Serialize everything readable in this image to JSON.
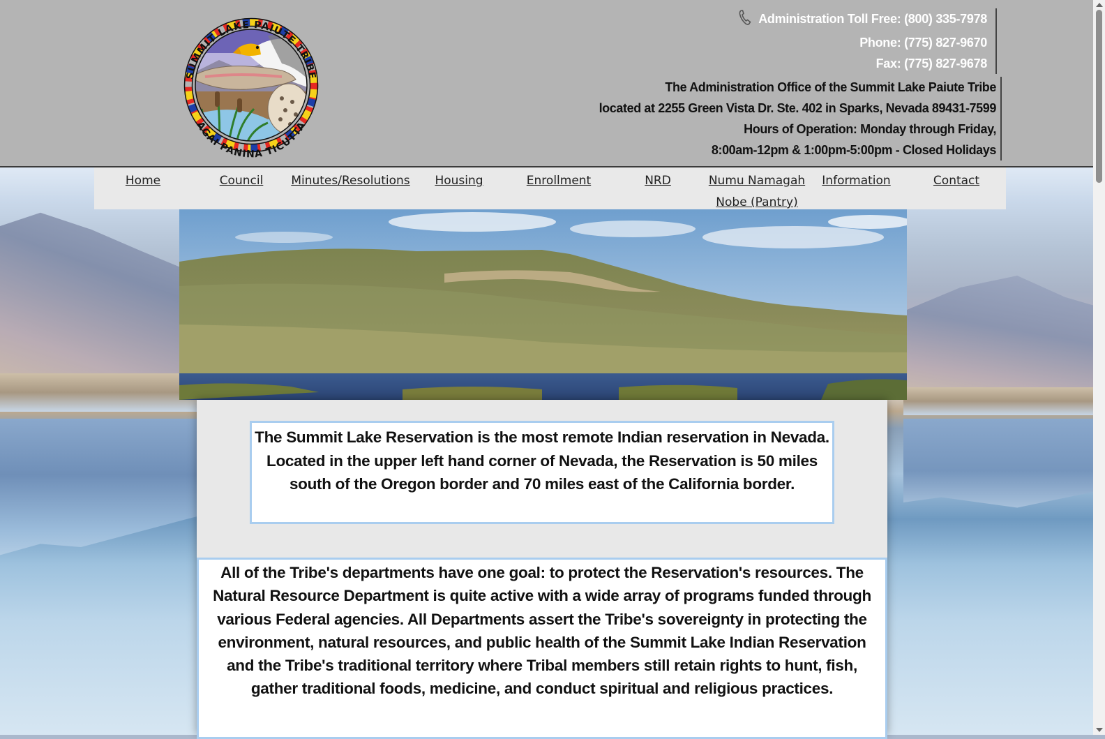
{
  "header": {
    "logo_text_top": "SUMMIT LAKE PAIUTE TRIBE",
    "logo_text_bottom": "AGAI PANINA TICUTTA",
    "contact": {
      "toll_free": "Administration Toll Free: (800) 335-7978",
      "phone": "Phone: (775) 827-9670",
      "fax": "Fax: (775) 827-9678"
    },
    "office": {
      "line1": "The Administration Office of the Summit Lake Paiute Tribe",
      "line2": "located at 2255 Green Vista Dr. Ste. 402 in Sparks, Nevada 89431-7599",
      "line3": "Hours of Operation: Monday through Friday,",
      "line4": "8:00am-12pm & 1:00pm-5:00pm - Closed Holidays"
    }
  },
  "nav": {
    "home": "Home",
    "council": "Council",
    "minutes": "Minutes/Resolutions",
    "housing": "Housing",
    "enrollment": "Enrollment",
    "nrd": "NRD",
    "pantry_line1": "Numu Namagah",
    "pantry_line2": "Nobe (Pantry)",
    "information": "Information",
    "contact": "Contact"
  },
  "content": {
    "intro": "The Summit Lake Reservation is the most remote Indian reservation in Nevada. Located in the upper left hand corner of Nevada, the Reservation is 50 miles south of the Oregon border and 70 miles east of the California border.",
    "mission": "All of the Tribe's departments have one goal: to protect the Reservation's resources. The Natural Resource Department is quite active with a wide array of programs funded through various Federal agencies. All Departments assert the Tribe's sovereignty in protecting the environment, natural resources, and public health of the Summit Lake Indian Reservation and the Tribe's traditional territory where Tribal members still retain rights to hunt, fish, gather traditional foods, medicine, and conduct spiritual and religious practices."
  },
  "icons": {
    "phone": "phone-icon"
  }
}
